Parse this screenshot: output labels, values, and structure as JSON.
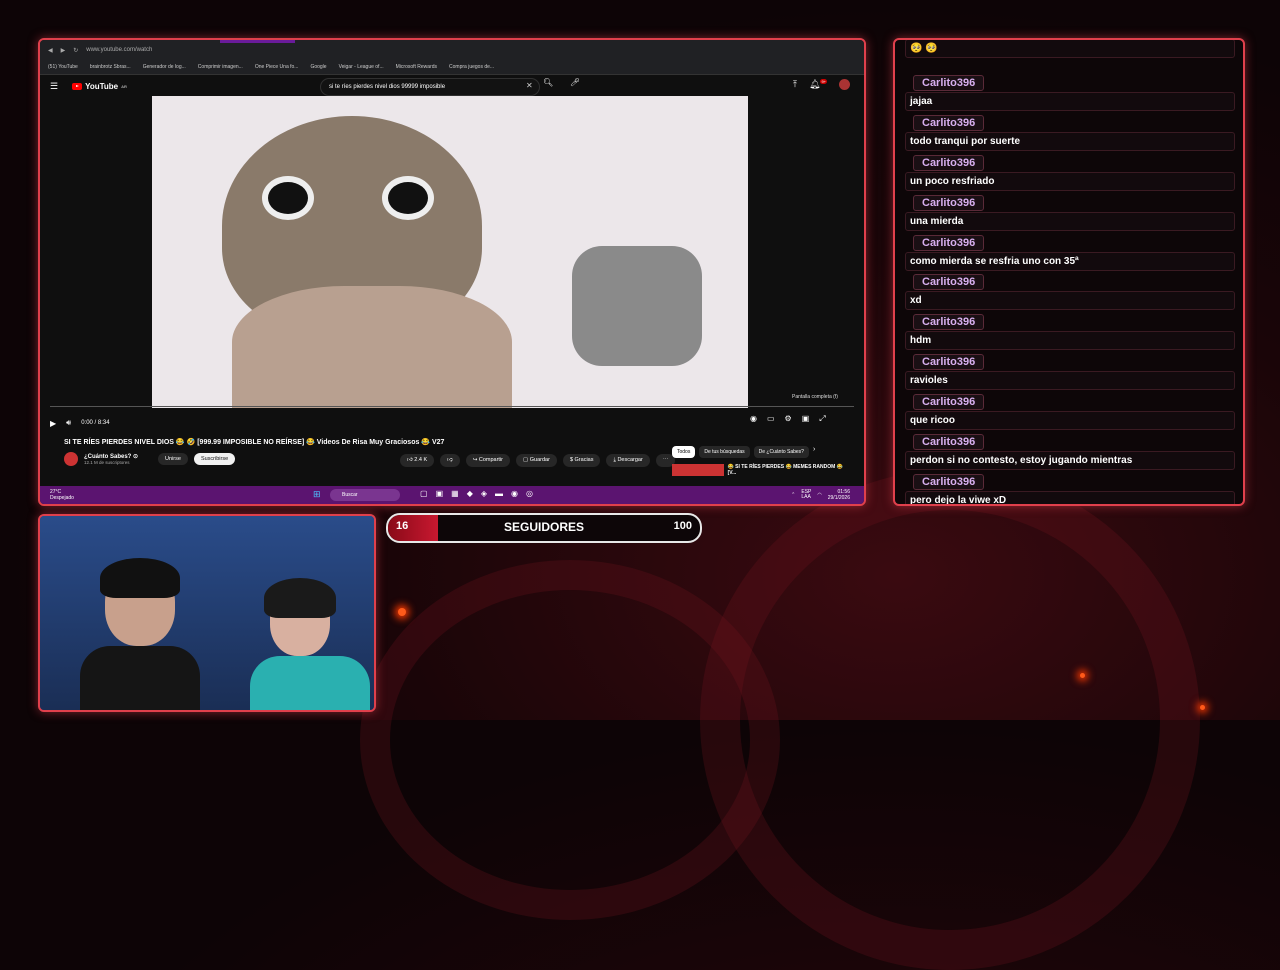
{
  "browser": {
    "url": "www.youtube.com/watch",
    "bookmarks": [
      "(51) YouTube",
      "brainbrotz Sbras...",
      "Generador de log...",
      "Comprimir imagen...",
      "One Piece Una fo...",
      "Google",
      "Veigar - League of...",
      "Microsoft Rewards",
      "Compra juegos de..."
    ]
  },
  "youtube": {
    "logo": "YouTube",
    "logo_sup": "AR",
    "search_value": "si te ríes pierdes nivel dios 99999 imposible",
    "notifications_badge": "9+",
    "video": {
      "time": "0:00 / 8:34",
      "fullscreen_tip": "Pantalla completa (f)",
      "title": "SI TE RÍES PIERDES NIVEL DIOS 😂 🤣 [999.99 IMPOSIBLE NO REÍRSE] 😂 Videos De Risa Muy Graciosos 😂 V27"
    },
    "channel": {
      "name": "¿Cuánto Sabes? ⊙",
      "subs": "12.1 M de suscriptores",
      "join": "Unirse",
      "subscribe": "Suscribirse"
    },
    "actions": {
      "likes": "2.4 K",
      "share": "Compartir",
      "save": "Guardar",
      "thanks": "Gracias",
      "download": "Descargar"
    },
    "chips": [
      "Todos",
      "De tus búsquedas",
      "De ¿Cuánto Sabes?"
    ],
    "recommendation_title": "😂 SI TE RÍES PIERDES 😂 MEMES RANDOM 😂 [V..."
  },
  "taskbar": {
    "temp": "27°C",
    "weather": "Despejado",
    "search": "Buscar",
    "lang": "ESP\nLAA",
    "time": "01:56",
    "date": "29/1/2026"
  },
  "chat": [
    {
      "user": "Carlito396",
      "text": "🥺 🥺"
    },
    {
      "user": "Carlito396",
      "text": "jajaa"
    },
    {
      "user": "Carlito396",
      "text": "todo tranqui por suerte"
    },
    {
      "user": "Carlito396",
      "text": "un poco resfriado"
    },
    {
      "user": "Carlito396",
      "text": "una mierda"
    },
    {
      "user": "Carlito396",
      "text": "como mierda se resfria uno con 35ª"
    },
    {
      "user": "Carlito396",
      "text": "xd"
    },
    {
      "user": "Carlito396",
      "text": "hdm"
    },
    {
      "user": "Carlito396",
      "text": "ravioles"
    },
    {
      "user": "Carlito396",
      "text": "que ricoo"
    },
    {
      "user": "Carlito396",
      "text": "perdon si no contesto, estoy jugando mientras"
    },
    {
      "user": "Carlito396",
      "text": "pero dejo la viwe xD"
    }
  ],
  "followers": {
    "current": "16",
    "label": "SEGUIDORES",
    "goal": "100",
    "progress": 0.16
  },
  "colors": {
    "frame": "#e0404c",
    "chat_name": "#d8b0f0",
    "taskbar": "#5b1470"
  }
}
